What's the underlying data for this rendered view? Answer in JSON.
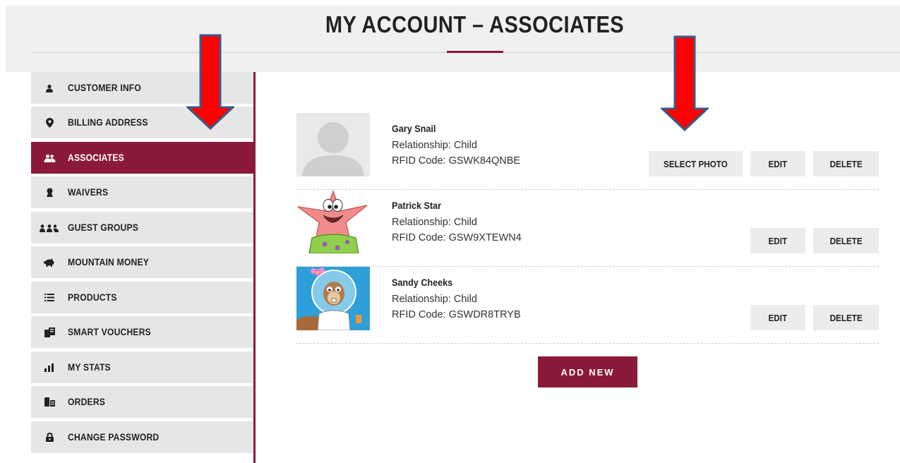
{
  "header": {
    "title": "MY ACCOUNT – ASSOCIATES"
  },
  "sidebar": {
    "items": [
      {
        "label": "CUSTOMER INFO",
        "icon": "user-icon",
        "active": false
      },
      {
        "label": "BILLING ADDRESS",
        "icon": "map-pin-icon",
        "active": false
      },
      {
        "label": "ASSOCIATES",
        "icon": "users-icon",
        "active": true
      },
      {
        "label": "WAIVERS",
        "icon": "signature-icon",
        "active": false
      },
      {
        "label": "GUEST GROUPS",
        "icon": "group-icon",
        "active": false
      },
      {
        "label": "MOUNTAIN MONEY",
        "icon": "piggy-bank-icon",
        "active": false
      },
      {
        "label": "PRODUCTS",
        "icon": "list-icon",
        "active": false
      },
      {
        "label": "SMART VOUCHERS",
        "icon": "voucher-icon",
        "active": false
      },
      {
        "label": "MY STATS",
        "icon": "bar-chart-icon",
        "active": false
      },
      {
        "label": "ORDERS",
        "icon": "orders-icon",
        "active": false
      },
      {
        "label": "CHANGE PASSWORD",
        "icon": "lock-icon",
        "active": false
      }
    ]
  },
  "associates": [
    {
      "name": "Gary Snail",
      "relationship": "Relationship: Child",
      "rfid": "RFID Code: GSWK84QNBE",
      "photo": "placeholder-avatar",
      "has_select_photo": true
    },
    {
      "name": "Patrick Star",
      "relationship": "Relationship: Child",
      "rfid": "RFID Code: GSW9XTEWN4",
      "photo": "patrick-star-image",
      "has_select_photo": false
    },
    {
      "name": "Sandy Cheeks",
      "relationship": "Relationship: Child",
      "rfid": "RFID Code: GSWDR8TRYB",
      "photo": "sandy-cheeks-image",
      "has_select_photo": false
    }
  ],
  "buttons": {
    "select_photo": "SELECT PHOTO",
    "edit": "EDIT",
    "delete": "DELETE",
    "add_new": "ADD NEW"
  },
  "colors": {
    "accent": "#8b1a3a",
    "arrow": "#ff0000",
    "arrow_outline": "#3a5a8c"
  }
}
